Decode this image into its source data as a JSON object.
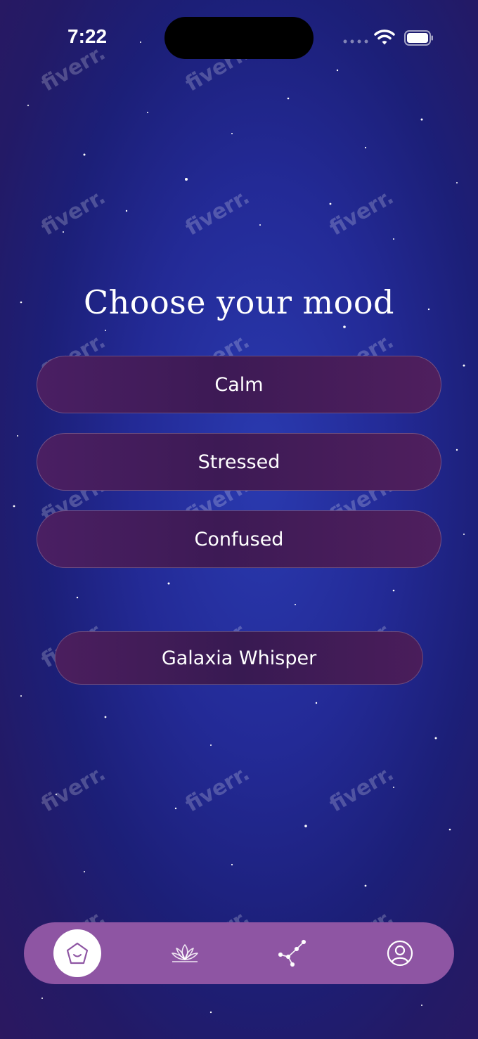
{
  "status_bar": {
    "time": "7:22"
  },
  "title": "Choose your mood",
  "moods": [
    {
      "label": "Calm"
    },
    {
      "label": "Stressed"
    },
    {
      "label": "Confused"
    }
  ],
  "whisper_button": {
    "label": "Galaxia Whisper"
  },
  "tab_bar": {
    "tabs": [
      {
        "icon": "home-icon",
        "selected": true
      },
      {
        "icon": "lotus-icon",
        "selected": false
      },
      {
        "icon": "constellation-icon",
        "selected": false
      },
      {
        "icon": "profile-icon",
        "selected": false
      }
    ]
  },
  "watermark": "fiverr.",
  "colors": {
    "button_fill": "#4a1f63",
    "tab_bar": "#8e55a3",
    "background": "#232a96"
  }
}
